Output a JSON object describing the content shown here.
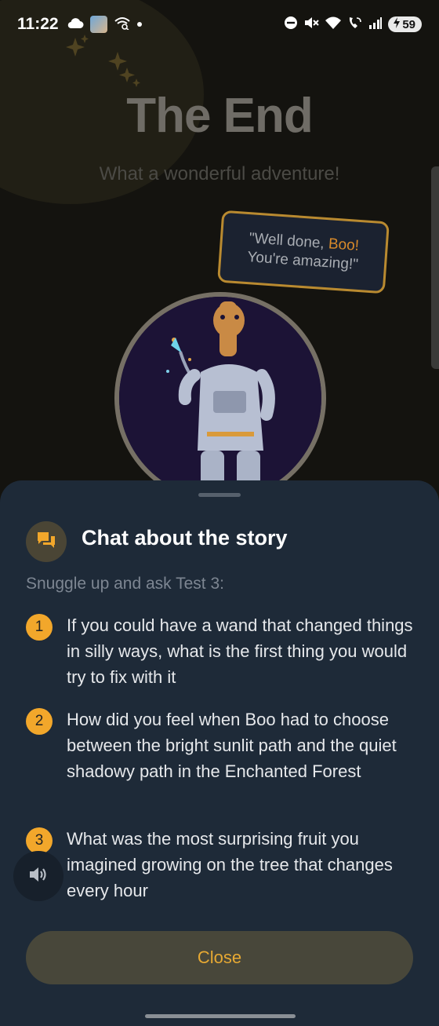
{
  "status_bar": {
    "time": "11:22",
    "battery": "59",
    "left_icons": [
      "cloud-icon",
      "app-avatar-icon",
      "wifi-calling-icon",
      "dot-icon"
    ],
    "right_icons": [
      "dnd-icon",
      "mute-icon",
      "wifi-icon",
      "wifi-call-icon",
      "signal-icon",
      "battery-icon"
    ]
  },
  "background": {
    "title": "The End",
    "subtitle": "What a wonderful adventure!",
    "speech_prefix": "\"Well done, ",
    "speech_name": "Boo!",
    "speech_suffix": "You're amazing!\"",
    "portrait_icon": "giraffe-astronaut-illustration"
  },
  "sheet": {
    "title": "Chat about the story",
    "subtitle": "Snuggle up and ask Test 3:",
    "questions": [
      {
        "num": "1",
        "text": "If you could have a wand that changed things in silly ways, what is the first thing you would try to fix with it"
      },
      {
        "num": "2",
        "text": "How did you feel when Boo had to choose between the bright sunlit path and the quiet shadowy path in the Enchanted Forest"
      },
      {
        "num": "3",
        "text": "What was the most surprising fruit you imagined growing on the tree that changes every hour"
      }
    ],
    "close_label": "Close"
  },
  "colors": {
    "accent": "#f2a72b",
    "sheet_bg": "#1e2a38",
    "close_bg": "#48473a",
    "close_text": "#e7a933"
  }
}
